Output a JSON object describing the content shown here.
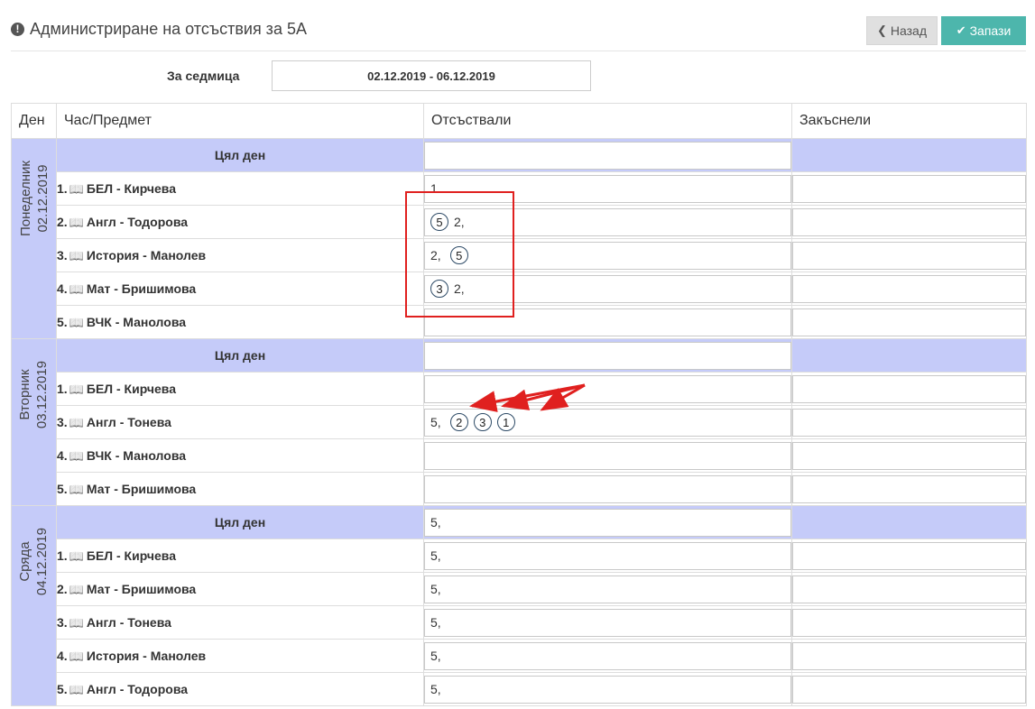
{
  "header": {
    "title": "Администриране на отсъствия за 5А",
    "back_label": "Назад",
    "save_label": "Запази"
  },
  "week": {
    "label": "За седмица",
    "value": "02.12.2019 - 06.12.2019"
  },
  "table": {
    "columns": [
      "Ден",
      "Час/Предмет",
      "Отсъствали",
      "Закъснели"
    ],
    "days": [
      {
        "name": "Понеделник",
        "date": "02.12.2019",
        "allday": {
          "label": "Цял ден",
          "absent": ""
        },
        "lessons": [
          {
            "num": "1.",
            "subject": "БЕЛ - Кирчева",
            "absent": "1",
            "late": ""
          },
          {
            "num": "2.",
            "subject": "Англ - Тодорова",
            "absent": "⑤ 2,",
            "late": ""
          },
          {
            "num": "3.",
            "subject": "История - Манолев",
            "absent": "2, ⑤",
            "late": ""
          },
          {
            "num": "4.",
            "subject": "Мат - Бришимова",
            "absent": "③ 2,",
            "late": ""
          },
          {
            "num": "5.",
            "subject": "ВЧК - Манолова",
            "absent": "",
            "late": ""
          }
        ]
      },
      {
        "name": "Вторник",
        "date": "03.12.2019",
        "allday": {
          "label": "Цял ден",
          "absent": ""
        },
        "lessons": [
          {
            "num": "1.",
            "subject": "БЕЛ - Кирчева",
            "absent": "",
            "late": ""
          },
          {
            "num": "3.",
            "subject": "Англ - Тонева",
            "absent": "5, ② ③ ①",
            "late": ""
          },
          {
            "num": "4.",
            "subject": "ВЧК - Манолова",
            "absent": "",
            "late": ""
          },
          {
            "num": "5.",
            "subject": "Мат - Бришимова",
            "absent": "",
            "late": ""
          }
        ]
      },
      {
        "name": "Сряда",
        "date": "04.12.2019",
        "allday": {
          "label": "Цял ден",
          "absent": "5,"
        },
        "lessons": [
          {
            "num": "1.",
            "subject": "БЕЛ - Кирчева",
            "absent": "5,",
            "late": ""
          },
          {
            "num": "2.",
            "subject": "Мат - Бришимова",
            "absent": "5,",
            "late": ""
          },
          {
            "num": "3.",
            "subject": "Англ - Тонева",
            "absent": "5,",
            "late": ""
          },
          {
            "num": "4.",
            "subject": "История - Манолев",
            "absent": "5,",
            "late": ""
          },
          {
            "num": "5.",
            "subject": "Англ - Тодорова",
            "absent": "5,",
            "late": ""
          }
        ]
      }
    ]
  },
  "colors": {
    "day_band": "#c5cbf9",
    "save_button": "#4db6ac",
    "annotation_red": "#e0201f"
  },
  "icons": {
    "title": "exclamation-circle-icon",
    "back": "chevron-left-icon",
    "save": "check-icon",
    "subject": "book-icon"
  }
}
